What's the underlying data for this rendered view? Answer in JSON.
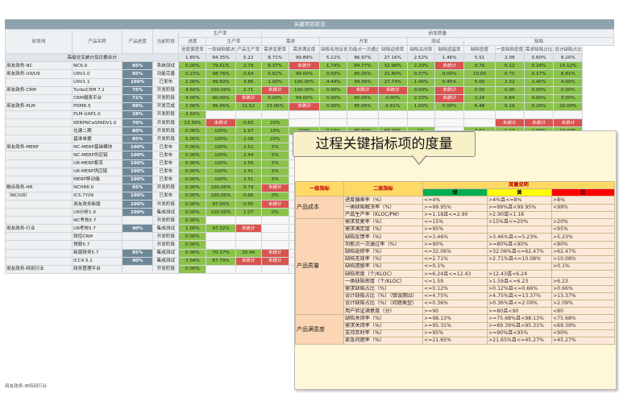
{
  "title": "关键项目状况",
  "header": {
    "col_product_line": "研发线",
    "col_product_name": "产品名称",
    "col_progress": "产品进度",
    "col_stage": "当前阶段",
    "grp_production": "生产率",
    "grp_progress": "进度",
    "grp_efficiency": "生产率",
    "grp_dev_quality": "研发质量",
    "grp_req": "需求",
    "grp_dev": "开发",
    "grp_test": "测试",
    "grp_defect": "缺陷",
    "sub": [
      "进度偏差率",
      "一类缺陷解决率",
      "产品生产率",
      "需求变更率",
      "需求满足度",
      "缺陷有效反馈率",
      "功能点一次通过率",
      "缺陷返修率",
      "缺陷关闭率",
      "缺陷遗留率",
      "缺陷密度",
      "一类缺陷密度",
      "需求缺陷占比",
      "设计缺陷占比"
    ]
  },
  "stats_label": "高级交叉统计及日报合计",
  "stats_values": [
    "1.65%",
    "94.35%",
    "5.22",
    "8.71%",
    "99.89%",
    "5.12%",
    "86.97%",
    "27.16%",
    "2.52%",
    "1.46%",
    "5.51",
    "2.08",
    "0.60%",
    "9.20%"
  ],
  "rows": [
    {
      "line": "用友政务-NC",
      "name": "NC6.0",
      "pct": "85%",
      "stage": "系统测试",
      "v": [
        "0.00%",
        "79.61%",
        "2.79",
        "6.37%",
        "未统计",
        "1.74%",
        "84.77%",
        "32.96%",
        "2.20%",
        "未统计",
        "0.76",
        "0.12",
        "0.14%",
        "14.12%"
      ]
    },
    {
      "line": "用友政务-U9/U9",
      "name": "U9V1.0",
      "pct": "95%",
      "stage": "功能完善",
      "v": [
        "0.23%",
        "98.76%",
        "0.64",
        "5.81%",
        "99.00%",
        "0.00%",
        "80.00%",
        "21.80%",
        "0.37%",
        "0.00%",
        "10.00",
        "0.70",
        "0.17%",
        "8.81%"
      ]
    },
    {
      "line": "",
      "name": "U9V1.1",
      "pct": "100%",
      "stage": "已发布",
      "v": [
        "1.00%",
        "99.50%",
        "3.86",
        "1.00%",
        "100.00%",
        "4.44%",
        "99.99%",
        "27.74%",
        "1.45%",
        "0.45%",
        "5.00",
        "2.32",
        "2.40%",
        "4.90%"
      ]
    },
    {
      "line": "用友政务-CRM",
      "name": "TurboCRM 7.1",
      "pct": "75%",
      "stage": "开发阶段",
      "v": [
        "4.50%",
        "100.00%",
        "2.71",
        "未统计",
        "100.00%",
        "0.00%",
        "未统计",
        "未统计",
        "0.00%",
        "未统计",
        "0.00",
        "0.00",
        "0.00%",
        "0.00%"
      ]
    },
    {
      "line": "",
      "name": "CRM报表平台",
      "pct": "71%",
      "stage": "开发阶段",
      "v": [
        "4.00%",
        "90.00%",
        "未统计",
        "0.00%",
        "99.00%",
        "0.00%",
        "80.00%",
        "0.00%",
        "2.33%",
        "未统计",
        "2.24",
        "0.84",
        "4.00%",
        "3.00%"
      ]
    },
    {
      "line": "用友政务-PLM",
      "name": "PDM6.5",
      "pct": "99%",
      "stage": "开发完成",
      "v": [
        "1.00%",
        "95.45%",
        "11.52",
        "13.00%",
        "未统计",
        "0.00%",
        "85.00%",
        "6.81%",
        "1.00%",
        "0.00%",
        "6.48",
        "0.19",
        "0.26%",
        "20.00%"
      ]
    },
    {
      "line": "",
      "name": "PLM-UAP1.0",
      "pct": "28%",
      "stage": "开发阶段",
      "v": [
        "2.50%",
        "",
        "",
        "",
        "",
        "",
        "",
        "",
        "",
        "",
        "",
        "",
        "",
        ""
      ]
    },
    {
      "line": "",
      "name": "KERPNCeSPADV1.0",
      "pct": "70%",
      "stage": "开发阶段",
      "v": [
        "13.30%",
        "未统计",
        "0.60",
        "20%",
        "",
        "",
        "",
        "",
        "",
        "",
        "",
        "未统计",
        "未统计",
        "未统计"
      ]
    },
    {
      "line": "",
      "name": "住建二期",
      "pct": "80%",
      "stage": "开发阶段",
      "v": [
        "0.00%",
        "100%",
        "1.97",
        "10%",
        "100%",
        "0.16%",
        "85.00%",
        "68.20%",
        "1%",
        "",
        "0.02",
        "1.27",
        "1.03%",
        "10.47%"
      ]
    },
    {
      "line": "",
      "name": "基准单据",
      "pct": "95%",
      "stage": "开发阶段",
      "v": [
        "5.00%",
        "100%",
        "2.09",
        "20%",
        "",
        "",
        "",
        "",
        "",
        "",
        "",
        "",
        "",
        ""
      ]
    },
    {
      "line": "用友政务-MERP",
      "name": "NC-MERP基础模块",
      "pct": "100%",
      "stage": "已发布",
      "v": [
        "0.00%",
        "100%",
        "2.52",
        "5%",
        "",
        "",
        "",
        "",
        "",
        "",
        "",
        "",
        "",
        ""
      ]
    },
    {
      "line": "",
      "name": "NC-MERP供应链",
      "pct": "100%",
      "stage": "已发布",
      "v": [
        "0.00%",
        "100%",
        "2.44",
        "5%",
        "",
        "",
        "",
        "",
        "",
        "",
        "",
        "",
        "",
        ""
      ]
    },
    {
      "line": "",
      "name": "U8-MERP客流",
      "pct": "100%",
      "stage": "已发布",
      "v": [
        "0.00%",
        "100%",
        "2.55",
        "5%",
        "",
        "",
        "",
        "",
        "",
        "",
        "",
        "",
        "",
        ""
      ]
    },
    {
      "line": "",
      "name": "U8-MERP供应链",
      "pct": "100%",
      "stage": "已发布",
      "v": [
        "0.00%",
        "100%",
        "2.41",
        "5%",
        "",
        "",
        "",
        "",
        "",
        "",
        "",
        "",
        "",
        ""
      ]
    },
    {
      "line": "",
      "name": "MERP移动端",
      "pct": "100%",
      "stage": "已发布",
      "v": [
        "0.00%",
        "100%",
        "2.51",
        "5%",
        "",
        "",
        "",
        "",
        "",
        "",
        "",
        "",
        "",
        ""
      ]
    },
    {
      "line": "融合政务-HR",
      "name": "NCHR6.0",
      "pct": "95%",
      "stage": "开发阶段",
      "v": [
        "0.00%",
        "100.00%",
        "0.79",
        "未统计",
        "",
        "",
        "",
        "",
        "",
        "",
        "",
        "",
        "",
        ""
      ]
    },
    {
      "line": "（NC/U9）",
      "name": "ICS.7Y/I9",
      "pct": "100%",
      "stage": "已发布",
      "v": [
        "0.00%",
        "100.00%",
        "0.66",
        "0%",
        "",
        "",
        "",
        "",
        "",
        "",
        "",
        "",
        "",
        ""
      ]
    },
    {
      "line": "",
      "name": "用友政务新版",
      "pct": "100%",
      "stage": "开发阶段",
      "v": [
        "0.00%",
        "97.00%",
        "0.95",
        "未统计",
        "",
        "",
        "",
        "",
        "",
        "",
        "",
        "",
        "",
        ""
      ]
    },
    {
      "line": "",
      "name": "U9分析1.0",
      "pct": "100%",
      "stage": "集成测试",
      "v": [
        "0.00%",
        "100.00%",
        "1.07",
        "0%",
        "",
        "",
        "",
        "",
        "",
        "",
        "",
        "",
        "",
        ""
      ]
    },
    {
      "line": "",
      "name": "NC考核5.7",
      "pct": "",
      "stage": "开发阶段",
      "v": [
        "0.00%",
        "",
        "",
        "",
        "",
        "",
        "",
        "",
        "",
        "",
        "",
        "",
        "",
        ""
      ]
    },
    {
      "line": "用友政务-行业",
      "name": "U9考核5.7",
      "pct": "90%",
      "stage": "集成测试",
      "v": [
        "1.00%",
        "97.32%",
        "未统计",
        "",
        "",
        "",
        "",
        "",
        "",
        "",
        "",
        "",
        "",
        ""
      ]
    },
    {
      "line": "",
      "name": "财控CRM",
      "pct": "",
      "stage": "开发阶段",
      "v": [
        "0.00%",
        "",
        "",
        "",
        "",
        "",
        "",
        "",
        "",
        "",
        "",
        "",
        "",
        ""
      ]
    },
    {
      "line": "",
      "name": "预算5.7",
      "pct": "",
      "stage": "开发阶段",
      "v": [
        "0.00%",
        "",
        "",
        "",
        "",
        "",
        "",
        "",
        "",
        "",
        "",
        "",
        "",
        ""
      ]
    },
    {
      "line": "",
      "name": "新版财务5.7",
      "pct": "95%",
      "stage": "集成测试",
      "v": [
        "0.00%",
        "70.37%",
        "30.44",
        "未统计",
        "",
        "",
        "",
        "",
        "",
        "",
        "",
        "",
        "",
        ""
      ]
    },
    {
      "line": "",
      "name": "ICC4.5.1",
      "pct": "90%",
      "stage": "集成测试",
      "v": [
        "7.04%",
        "87.79%",
        "未统计",
        "未统计",
        "",
        "",
        "",
        "",
        "",
        "",
        "",
        "",
        "",
        ""
      ]
    },
    {
      "line": "用友政务-特别行业",
      "name": "政务管理平台",
      "pct": "",
      "stage": "开发阶段",
      "v": [
        "0.00%",
        "",
        "",
        "",
        "",
        "",
        "",
        "",
        "",
        "",
        "",
        "",
        "",
        ""
      ]
    }
  ],
  "bottom_note": "用友政务-IB特别行业",
  "callout": "过程关键指标项的度量",
  "metric": {
    "h_level1": "一级指标",
    "h_level2": "二级指标",
    "h_desc": "度量说明",
    "h_green": "绿",
    "h_yellow": "黄",
    "h_red": "红",
    "groups": [
      {
        "cat": "产品成本",
        "rows": [
          {
            "k": "进度偏差率（%）",
            "g": "<=4%",
            "y": ">4%且<=8%",
            "r": ">8%"
          },
          {
            "k": "一类缺陷解决率（%）",
            "g": ">=99.95%",
            "y": ">=99%且<99.95%",
            "r": "<99%"
          },
          {
            "k": "产品生产率（KLOC/PM）",
            "g": ">=1.18且<=2.90",
            "y": ">2.90或<1.18",
            "r": ""
          }
        ]
      },
      {
        "cat": "产品质量",
        "rows": [
          {
            "k": "需求变更率（%）",
            "g": "<=15%",
            "y": ">15%且<=20%",
            "r": ">20%"
          },
          {
            "k": "需求满足度（%）",
            "g": ">=95%",
            "y": "",
            "r": "<95%"
          },
          {
            "k": "缺陷反馈率（%）",
            "g": "<=3.46%",
            "y": ">3.46%且<=5.23%",
            "r": ">5.23%"
          },
          {
            "k": "功能点一次通过率（%）",
            "g": ">=90%",
            "y": ">=80%且<90%",
            "r": "<80%"
          },
          {
            "k": "缺陷返修率（%）",
            "g": "<=32.06%",
            "y": ">32.06%且<=62.47%",
            "r": ">62.47%"
          },
          {
            "k": "缺陷无效率（%）",
            "g": "<=2.71%",
            "y": ">2.71%且<=10.08%",
            "r": ">10.08%"
          },
          {
            "k": "缺陷遗留率（%）",
            "g": "<=0.1%",
            "y": "",
            "r": ">0.1%"
          },
          {
            "k": "缺陷密度（个/KLOC）",
            "g": ">=6.24且<=12.43",
            "y": ">12.43或<6.24",
            "r": ""
          },
          {
            "k": "一类缺陷密度（个/KLOC）",
            "g": "<=1.59",
            "y": ">1.59且<=6.23",
            "r": ">6.23"
          },
          {
            "k": "需求缺陷占比（%）",
            "g": "<=0.12%",
            "y": ">0.12%且<=0.66%",
            "r": ">0.66%"
          },
          {
            "k": "设计缺陷占比（%）（错误原因）",
            "g": "<=4.75%",
            "y": ">4.75%且<=13.37%",
            "r": ">13.37%"
          },
          {
            "k": "设计缺陷占比（%）（问题类型）",
            "g": "<=0.36%",
            "y": ">0.36%且<=2.09%",
            "r": ">2.09%"
          },
          {
            "k": "用户验证满意度（分）",
            "g": ">=90",
            "y": ">=80且<90",
            "r": "<80"
          }
        ]
      },
      {
        "cat": "产品满意度",
        "rows": [
          {
            "k": "缺陷关闭率（%）",
            "g": ">=98.13%",
            "y": ">=75.68%且<98.13%",
            "r": "<75.68%"
          },
          {
            "k": "需求关闭率（%）",
            "g": ">=95.31%",
            "y": ">=69.39%且<95.31%",
            "r": "<69.39%"
          },
          {
            "k": "支持及时率（%）",
            "g": ">=95%",
            "y": ">=90%且<95%",
            "r": "<90%"
          },
          {
            "k": "紧急问题率（%）",
            "g": "<=21.65%",
            "y": ">21.65%且<=45.27%",
            "r": ">45.27%"
          }
        ]
      }
    ]
  }
}
